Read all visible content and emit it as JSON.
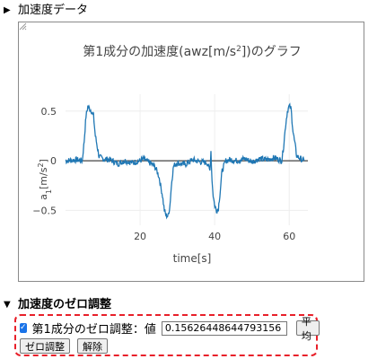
{
  "sections": {
    "accel_data": {
      "toggle_icon": "triangle-right-icon",
      "label": "加速度データ"
    },
    "zero_adjust": {
      "toggle_icon": "triangle-down-icon",
      "label": "加速度のゼロ調整"
    }
  },
  "zero_adjust": {
    "checkbox_checked": true,
    "checkbox_label": "第1成分のゼロ調整：値",
    "value": "0.15626448644793156",
    "average_button": "平均",
    "zero_button": "ゼロ調整",
    "release_button": "解除"
  },
  "colors": {
    "line": "#1f77b4",
    "grid": "#eeeeee",
    "panel_border": "#e8202a",
    "checkbox": "#1a73e8"
  },
  "chart_data": {
    "type": "line",
    "title": "第1成分の加速度(awz[m/s²])のグラフ",
    "xlabel": "time[s]",
    "ylabel": "a₁[m/s²]",
    "xlim": [
      0,
      65
    ],
    "ylim": [
      -0.65,
      0.67
    ],
    "xticks": [
      20,
      40,
      60
    ],
    "xtick_labels": [
      "20",
      "40",
      "60"
    ],
    "yticks": [
      0.5,
      0,
      -0.5
    ],
    "ytick_labels": [
      "0.5",
      "0",
      "−0.5"
    ],
    "grid": true,
    "legend": "none",
    "series": [
      {
        "x": [
          0,
          3,
          4.5,
          5,
          5.5,
          6,
          6.5,
          7,
          7.5,
          8,
          9,
          10,
          12,
          14,
          16,
          18,
          20,
          21,
          22,
          23,
          24,
          25,
          26,
          26.5,
          27,
          27.5,
          28,
          28.5,
          29,
          30,
          32,
          34,
          36,
          38,
          38.7,
          39,
          39.3,
          39.6,
          40,
          40.5,
          41,
          41.5,
          42,
          43,
          44,
          46,
          48,
          50,
          52,
          54,
          56,
          58,
          58.5,
          59,
          59.5,
          60,
          60.5,
          61,
          62,
          63,
          64
        ],
        "y": [
          0.0,
          0.01,
          0.0,
          0.2,
          0.45,
          0.55,
          0.52,
          0.5,
          0.45,
          0.25,
          0.04,
          0.02,
          0.01,
          -0.03,
          0.0,
          -0.02,
          0.0,
          0.02,
          -0.01,
          -0.03,
          -0.06,
          -0.15,
          -0.35,
          -0.5,
          -0.55,
          -0.56,
          -0.45,
          -0.2,
          -0.05,
          -0.02,
          -0.04,
          0.01,
          -0.01,
          -0.02,
          -0.1,
          0.1,
          -0.2,
          -0.35,
          -0.45,
          -0.5,
          -0.48,
          -0.3,
          -0.1,
          0.0,
          0.01,
          0.0,
          0.02,
          -0.01,
          0.02,
          0.01,
          0.03,
          0.0,
          0.15,
          0.35,
          0.5,
          0.55,
          0.52,
          0.3,
          0.05,
          0.02,
          0.0
        ]
      }
    ]
  }
}
